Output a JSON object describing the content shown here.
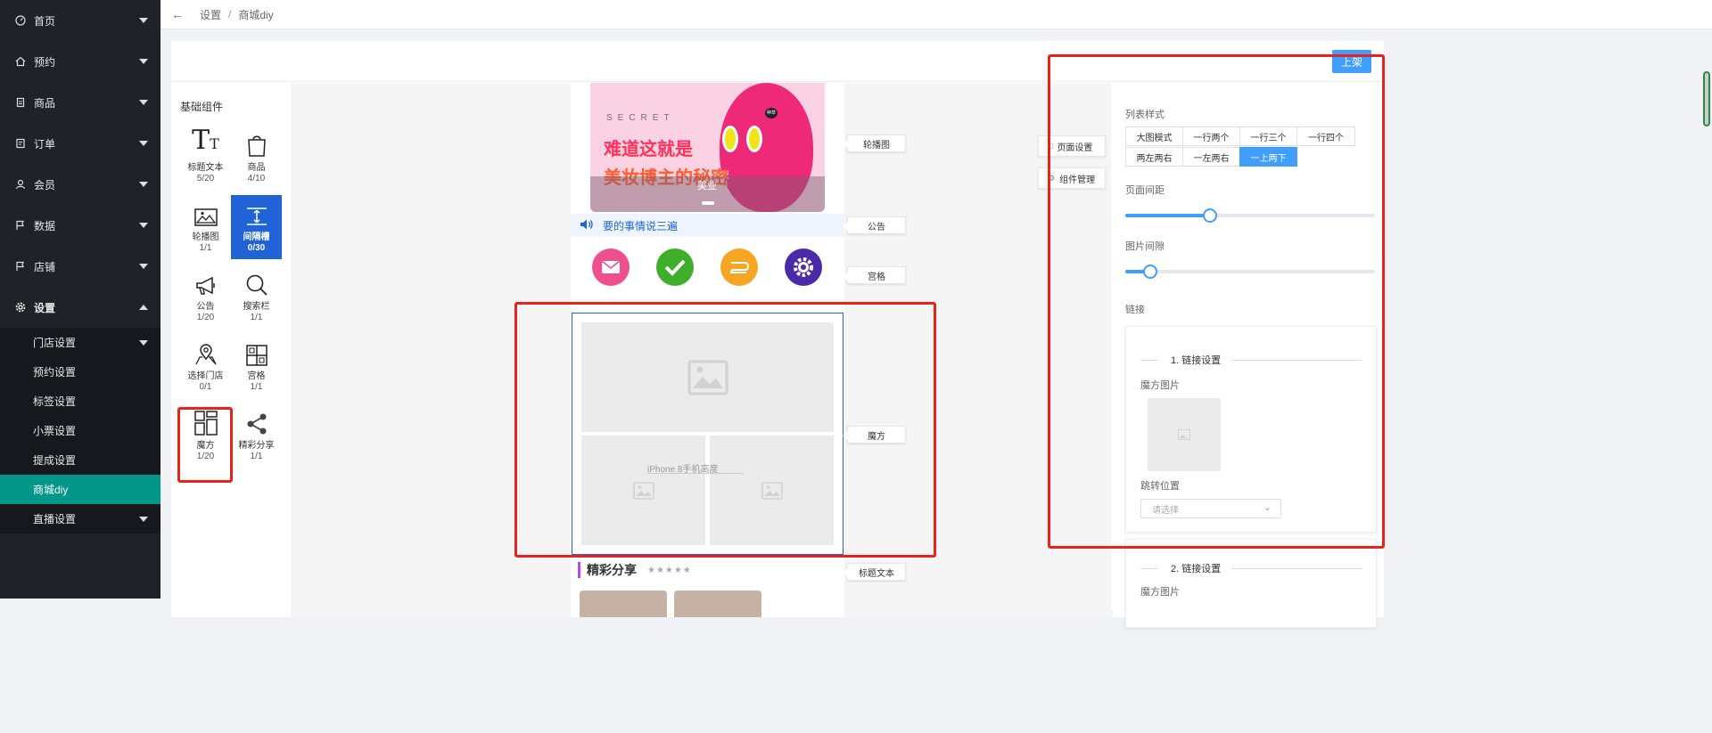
{
  "sidebar": {
    "items": [
      {
        "label": "首页",
        "icon": "dashboard-icon"
      },
      {
        "label": "预约",
        "icon": "home-icon"
      },
      {
        "label": "商品",
        "icon": "goods-icon"
      },
      {
        "label": "订单",
        "icon": "order-icon"
      },
      {
        "label": "会员",
        "icon": "member-icon"
      },
      {
        "label": "数据",
        "icon": "flag-icon"
      },
      {
        "label": "店铺",
        "icon": "flag-icon"
      },
      {
        "label": "设置",
        "icon": "gear-icon"
      }
    ],
    "submenu": [
      {
        "label": "门店设置"
      },
      {
        "label": "预约设置"
      },
      {
        "label": "标签设置"
      },
      {
        "label": "小票设置"
      },
      {
        "label": "提成设置"
      },
      {
        "label": "商城diy"
      },
      {
        "label": "直播设置"
      }
    ]
  },
  "breadcrumb": {
    "parent": "设置",
    "separator": "/",
    "current": "商城diy"
  },
  "header": {
    "publish_label": "上架"
  },
  "components": {
    "title": "基础组件",
    "items": [
      {
        "name": "标题文本",
        "count": "5/20",
        "icon": "text-title-icon"
      },
      {
        "name": "商品",
        "count": "4/10",
        "icon": "bag-icon"
      },
      {
        "name": "轮播图",
        "count": "1/1",
        "icon": "image-icon"
      },
      {
        "name": "间隔槽",
        "count": "0/30",
        "icon": "spacer-icon"
      },
      {
        "name": "公告",
        "count": "1/20",
        "icon": "megaphone-icon"
      },
      {
        "name": "搜索栏",
        "count": "1/1",
        "icon": "search-icon"
      },
      {
        "name": "选择门店",
        "count": "0/1",
        "icon": "map-pin-icon"
      },
      {
        "name": "宫格",
        "count": "1/1",
        "icon": "grid-icon"
      },
      {
        "name": "魔方",
        "count": "1/20",
        "icon": "cube-layout-icon"
      },
      {
        "name": "精彩分享",
        "count": "1/1",
        "icon": "share-icon"
      }
    ]
  },
  "preview": {
    "banner": {
      "secret": "SECRET",
      "title_line1": "难道这就是",
      "title_line2": "美妆博主的秘密",
      "caption": "美业",
      "tag": "种草"
    },
    "notice_text": "要的事情说三遍",
    "share_title": "精彩分享",
    "share_stars": "★★★★★",
    "phone_height_label": "iPhone 8手机高度",
    "labels": {
      "banner": "轮播图",
      "notice": "公告",
      "grid": "宫格",
      "cube": "魔方",
      "title_text": "标题文本"
    },
    "side_buttons": {
      "page_settings": "页面设置",
      "component_mgmt": "组件管理"
    }
  },
  "settings": {
    "list_style_label": "列表样式",
    "list_style_options": [
      "大图模式",
      "一行两个",
      "一行三个",
      "一行四个",
      "两左两右",
      "一左两右",
      "一上两下"
    ],
    "list_style_selected": "一上两下",
    "page_margin_label": "页面间距",
    "page_margin_value": 0.34,
    "image_gap_label": "图片间隙",
    "image_gap_value": 0.1,
    "link_label": "链接",
    "link_items": [
      {
        "title": "1. 链接设置",
        "image_label": "魔方图片",
        "jump_label": "跳转位置",
        "select_placeholder": "请选择"
      },
      {
        "title": "2. 链接设置",
        "image_label": "魔方图片"
      }
    ]
  },
  "colors": {
    "sidebar_bg": "#1f2329",
    "active_menu": "#009688",
    "primary": "#409eff",
    "component_active": "#1f63d6",
    "highlight_box": "#e8221d"
  }
}
